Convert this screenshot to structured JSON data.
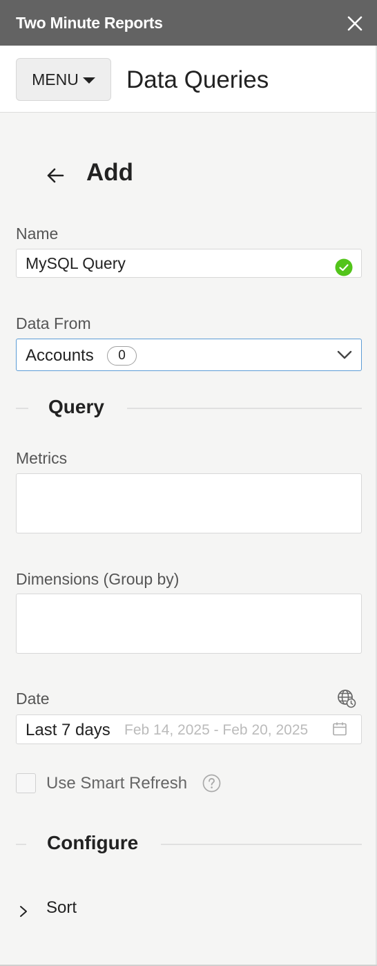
{
  "app": {
    "title": "Two Minute Reports"
  },
  "header": {
    "menu_label": "MENU",
    "page_title": "Data Queries"
  },
  "form": {
    "heading": "Add",
    "name": {
      "label": "Name",
      "value": "MySQL Query"
    },
    "data_from": {
      "label": "Data From",
      "value": "Accounts",
      "count": "0"
    },
    "query_section": "Query",
    "metrics": {
      "label": "Metrics"
    },
    "dimensions": {
      "label": "Dimensions (Group by)"
    },
    "date": {
      "label": "Date",
      "value": "Last 7 days",
      "range": "Feb 14, 2025 - Feb 20, 2025"
    },
    "smart_refresh": {
      "label": "Use Smart Refresh",
      "checked": false
    },
    "configure_section": "Configure",
    "sort": {
      "label": "Sort"
    }
  },
  "icons": {
    "close": "close-icon",
    "back": "arrow-left-icon",
    "valid": "check-circle-icon",
    "dropdown": "chevron-down-icon",
    "timezone": "globe-clock-icon",
    "calendar": "calendar-icon",
    "help": "question-circle-icon",
    "expand": "chevron-right-icon"
  },
  "colors": {
    "titlebar": "#636363",
    "valid": "#52c41a",
    "focus_border": "#5b9bd5"
  }
}
